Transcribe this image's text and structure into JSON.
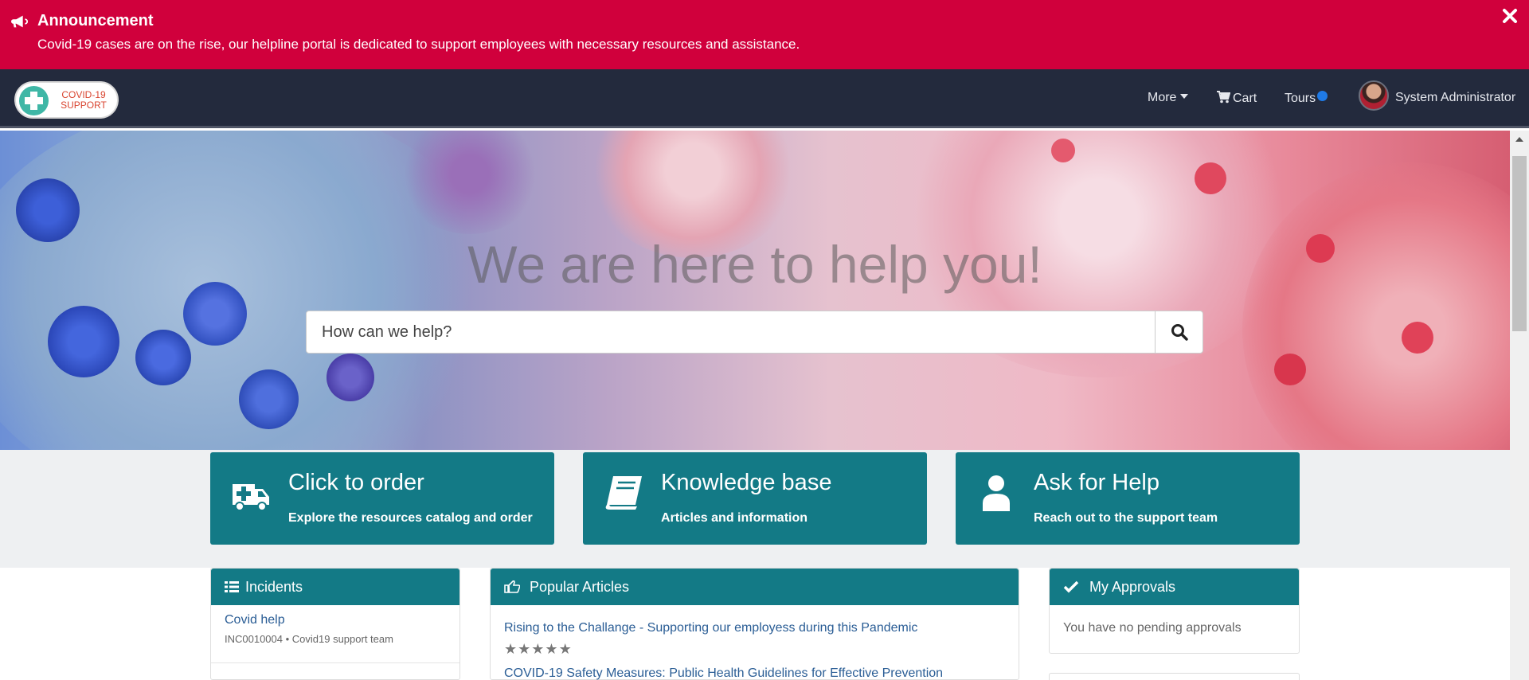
{
  "announcement": {
    "title": "Announcement",
    "text": "Covid-19 cases are on the rise, our helpline portal is dedicated to support employees with necessary resources and assistance.",
    "bg_color": "#d0003c"
  },
  "navbar": {
    "logo_line1": "COVID-19",
    "logo_line2": "SUPPORT",
    "more_label": "More",
    "cart_label": "Cart",
    "tours_label": "Tours",
    "user_name": "System Administrator",
    "bg_color": "#232a3d"
  },
  "hero": {
    "title": "We are here to help you!",
    "search_placeholder": "How can we help?"
  },
  "tiles": [
    {
      "title": "Click to order",
      "subtitle": "Explore the resources catalog and order",
      "icon": "ambulance-icon"
    },
    {
      "title": "Knowledge base",
      "subtitle": "Articles and information",
      "icon": "book-icon"
    },
    {
      "title": "Ask for Help",
      "subtitle": "Reach out to the support team",
      "icon": "user-icon"
    }
  ],
  "incidents": {
    "title": "Incidents",
    "items": [
      {
        "title": "Covid help",
        "meta": "INC0010004 • Covid19 support team"
      }
    ]
  },
  "popular_articles": {
    "title": "Popular Articles",
    "items": [
      {
        "title": "Rising to the Challange - Supporting our employess during this Pandemic",
        "rating": 5
      },
      {
        "title": "COVID-19 Safety Measures: Public Health Guidelines for Effective Prevention"
      }
    ]
  },
  "approvals": {
    "title": "My Approvals",
    "empty_text": "You have no pending approvals"
  },
  "theme": {
    "accent": "#137a86",
    "link": "#2a5d95"
  }
}
